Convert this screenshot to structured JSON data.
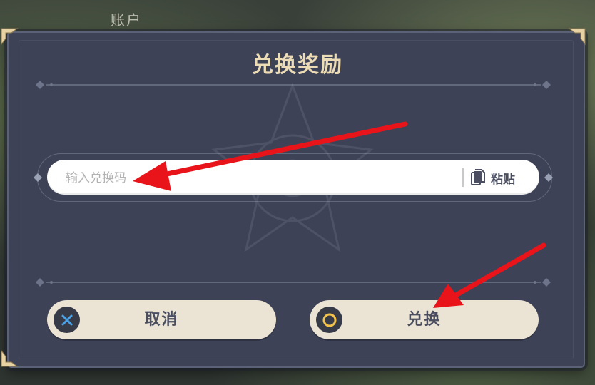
{
  "background": {
    "tab_label": "账户"
  },
  "dialog": {
    "title": "兑换奖励",
    "input": {
      "placeholder": "输入兑换码",
      "value": ""
    },
    "paste_label": "粘贴",
    "cancel_label": "取消",
    "confirm_label": "兑换"
  },
  "icons": {
    "paste": "clipboard-icon",
    "cancel": "x-icon",
    "confirm": "circle-icon"
  },
  "colors": {
    "dialog_bg": "#3d4256",
    "title": "#ecdcb6",
    "button_bg": "#ebe4d4",
    "button_text": "#4a4e60",
    "cancel_icon": "#4aa3e8",
    "confirm_icon": "#f2c24a",
    "annotation_arrow": "#e8141a"
  }
}
